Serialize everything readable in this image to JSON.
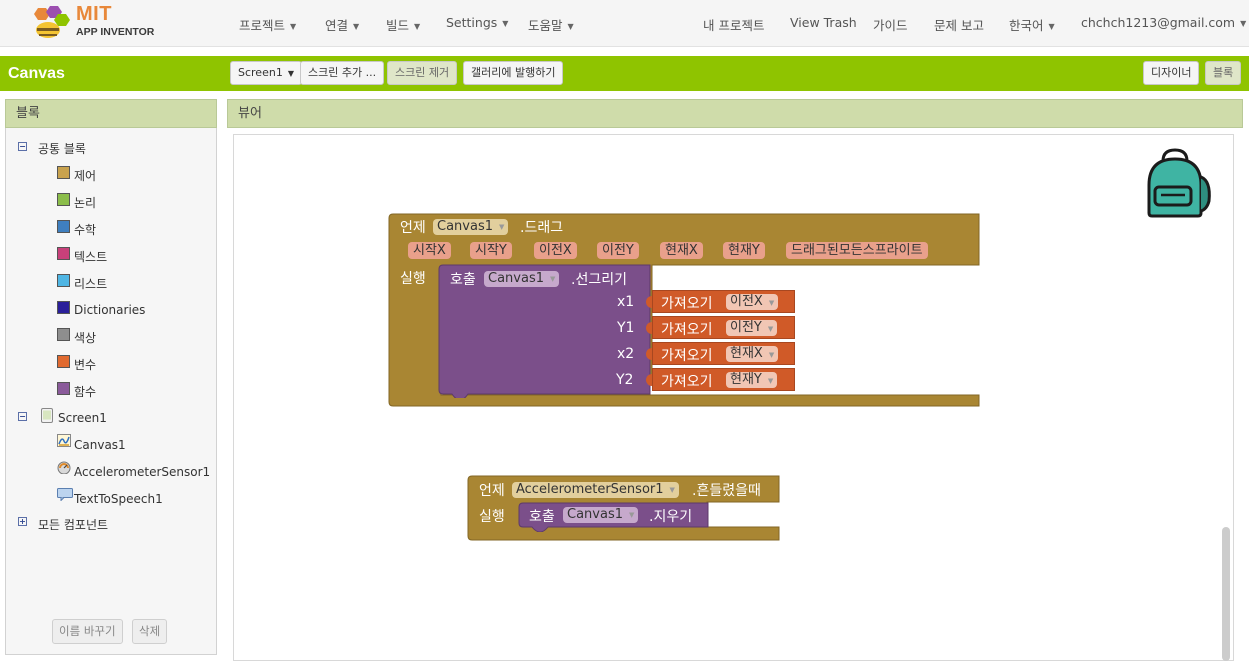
{
  "header": {
    "logo_title": "MIT",
    "logo_subtitle": "APP INVENTOR",
    "menu_left": [
      "프로젝트",
      "연결",
      "빌드",
      "Settings",
      "도움말"
    ],
    "menu_right": [
      "내 프로젝트",
      "View Trash",
      "가이드",
      "문제 보고"
    ],
    "language": "한국어",
    "user_email": "chchch1213@gmail.com"
  },
  "toolbar": {
    "project_name": "Canvas",
    "screen_select": "Screen1",
    "add_screen": "스크린 추가 ...",
    "remove_screen": "스크린 제거",
    "publish_gallery": "갤러리에 발행하기",
    "designer": "디자이너",
    "blocks": "블록"
  },
  "blocks_panel": {
    "header": "블록",
    "builtin_label": "공통 블록",
    "builtin": [
      {
        "label": "제어",
        "color": "#c8a24e"
      },
      {
        "label": "논리",
        "color": "#8bbd4a"
      },
      {
        "label": "수학",
        "color": "#3f7fbf"
      },
      {
        "label": "텍스트",
        "color": "#c8407a"
      },
      {
        "label": "리스트",
        "color": "#4fb6e4"
      },
      {
        "label": "Dictionaries",
        "color": "#2a1f9a"
      },
      {
        "label": "색상",
        "color": "#8e8e8e"
      },
      {
        "label": "변수",
        "color": "#e06a30"
      },
      {
        "label": "함수",
        "color": "#8a5a9a"
      }
    ],
    "screen_label": "Screen1",
    "components": [
      "Canvas1",
      "AccelerometerSensor1",
      "TextToSpeech1"
    ],
    "any_component": "모든 컴포넌트",
    "rename_button": "이름 바꾸기",
    "delete_button": "삭제"
  },
  "viewer": {
    "header": "뷰어",
    "drag_block": {
      "when": "언제",
      "component": "Canvas1",
      "event": ".드래그",
      "params": [
        "시작X",
        "시작Y",
        "이전X",
        "이전Y",
        "현재X",
        "현재Y",
        "드래그된모든스프라이트"
      ],
      "do": "실행",
      "call": "호출",
      "call_component": "Canvas1",
      "method": ".선그리기",
      "args": [
        {
          "name": "x1",
          "get": "가져오기",
          "var": "이전X"
        },
        {
          "name": "Y1",
          "get": "가져오기",
          "var": "이전Y"
        },
        {
          "name": "x2",
          "get": "가져오기",
          "var": "현재X"
        },
        {
          "name": "Y2",
          "get": "가져오기",
          "var": "현재Y"
        }
      ]
    },
    "shake_block": {
      "when": "언제",
      "component": "AccelerometerSensor1",
      "event": ".흔들렸을때",
      "do": "실행",
      "call": "호출",
      "call_component": "Canvas1",
      "method": ".지우기"
    }
  },
  "colors": {
    "green_bar": "#8fc400",
    "event_block": "#a98633",
    "procedure_block": "#7b4f8a",
    "get_block": "#d05a28"
  }
}
